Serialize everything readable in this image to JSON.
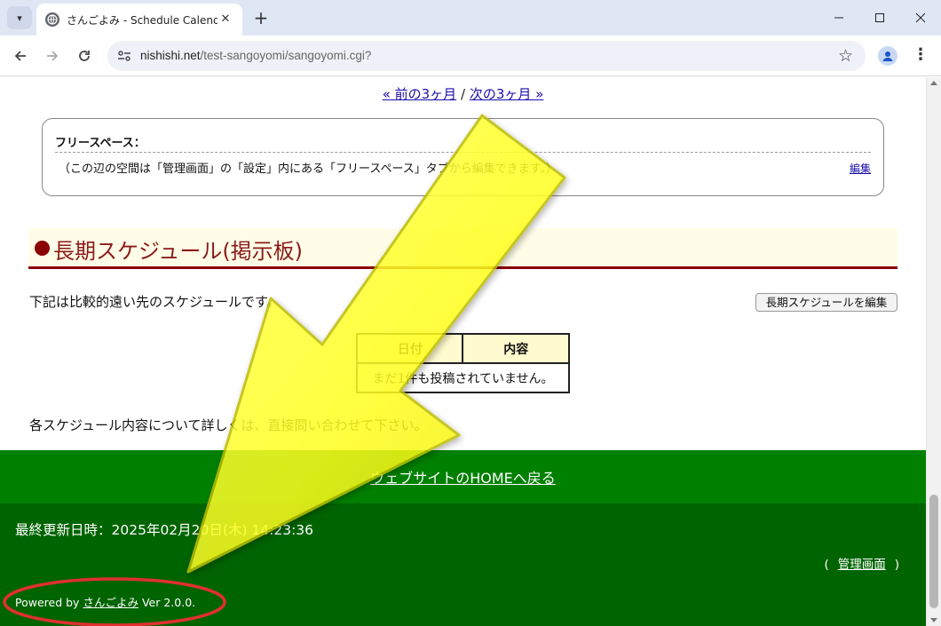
{
  "browser": {
    "tab_title": "さんごよみ - Schedule Calendar -",
    "url_host": "nishishi.net",
    "url_path": "/test-sangoyomi/sangoyomi.cgi?",
    "icons": [
      "tab-list-icon",
      "globe-icon",
      "close-icon",
      "plus-icon",
      "minimize-icon",
      "maximize-icon",
      "window-close-icon",
      "back-icon",
      "forward-icon",
      "reload-icon",
      "site-settings-icon",
      "star-icon",
      "profile-icon",
      "more-icon"
    ]
  },
  "pager": {
    "prev": "« 前の3ヶ月",
    "separator": "/",
    "next": "次の3ヶ月 »"
  },
  "freespace": {
    "title": "フリースペース：",
    "text": "（この辺の空間は「管理画面」の「設定」内にある「フリースペース」タブから編集できます。）",
    "edit": "編集"
  },
  "long_schedule": {
    "heading": "長期スケジュール(掲示板)",
    "description": "下記は比較的遠い先のスケジュールです。",
    "edit_button": "長期スケジュールを編集",
    "table": {
      "headers": [
        "日付",
        "内容"
      ],
      "empty": "まだ1件も投稿されていません。"
    },
    "note": "各スケジュール内容について詳しくは、直接問い合わせて下さい。"
  },
  "home_link": "ウェブサイトのHOMEへ戻る",
  "footer": {
    "updated": "最終更新日時：2025年02月20日(木) 14:23:36",
    "admin_open": "(",
    "admin_link": "管理画面",
    "admin_close": ")",
    "powered_prefix": "Powered by",
    "powered_link": "さんごよみ",
    "powered_version": "Ver 2.0.0."
  },
  "colors": {
    "heading": "#8b0000",
    "home_band": "#008000",
    "footer": "#006400",
    "arrow": "#ffff33",
    "ellipse": "#e03030"
  }
}
